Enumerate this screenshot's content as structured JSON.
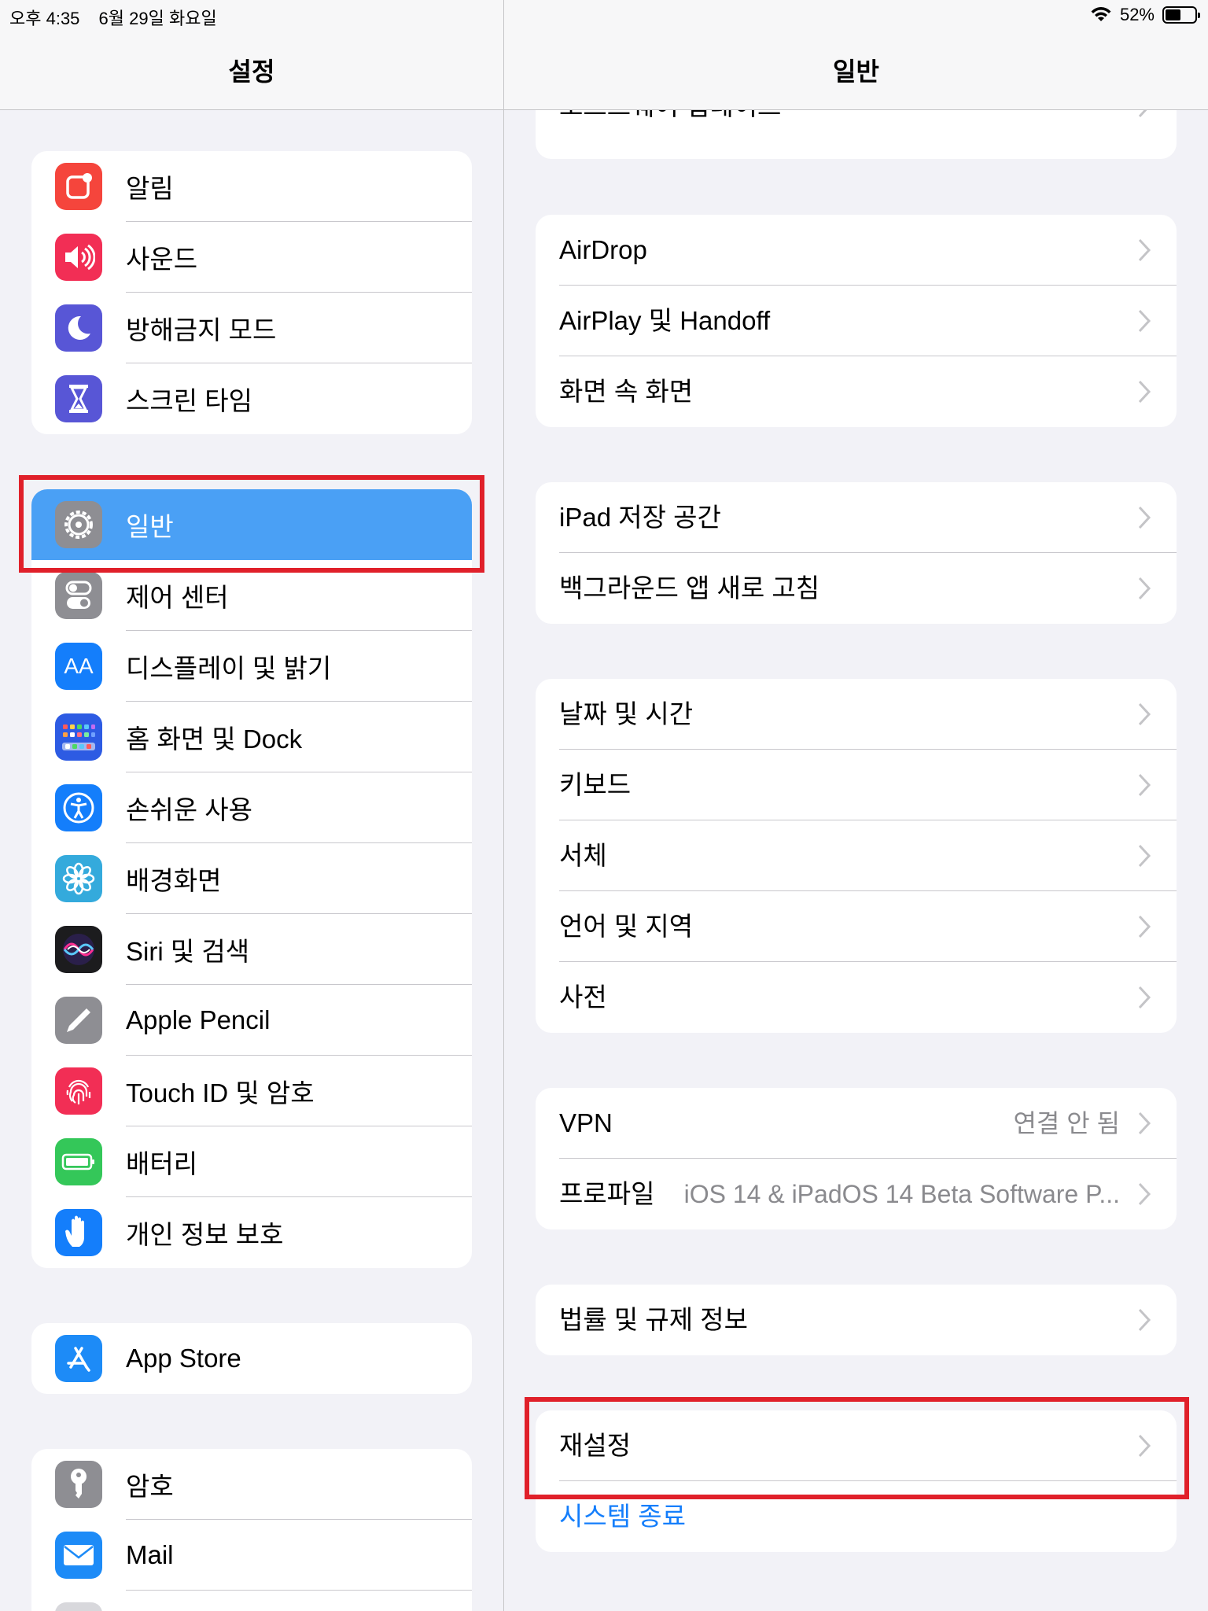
{
  "status_bar": {
    "time": "오후 4:35",
    "date": "6월 29일 화요일",
    "battery_percent": "52%",
    "battery_level": 0.52
  },
  "sidebar": {
    "title": "설정",
    "groups": [
      [
        {
          "label": "알림",
          "icon": "notification-icon",
          "color": "#f5453c"
        },
        {
          "label": "사운드",
          "icon": "speaker-icon",
          "color": "#f22e55"
        },
        {
          "label": "방해금지 모드",
          "icon": "moon-icon",
          "color": "#5856d6"
        },
        {
          "label": "스크린 타임",
          "icon": "hourglass-icon",
          "color": "#5856d6"
        }
      ],
      [
        {
          "label": "일반",
          "icon": "gear-icon",
          "color": "#8e8e93",
          "selected": true
        },
        {
          "label": "제어 센터",
          "icon": "toggle-icon",
          "color": "#8e8e93"
        },
        {
          "label": "디스플레이 및 밝기",
          "icon": "text-size-icon",
          "color": "#147efb"
        },
        {
          "label": "홈 화면 및 Dock",
          "icon": "home-grid-icon",
          "color": "#2d5be3"
        },
        {
          "label": "손쉬운 사용",
          "icon": "accessibility-icon",
          "color": "#147efb"
        },
        {
          "label": "배경화면",
          "icon": "flower-icon",
          "color": "#34aadc"
        },
        {
          "label": "Siri 및 검색",
          "icon": "siri-icon",
          "color": "#1c1c1e"
        },
        {
          "label": "Apple Pencil",
          "icon": "pencil-icon",
          "color": "#8e8e93"
        },
        {
          "label": "Touch ID 및 암호",
          "icon": "fingerprint-icon",
          "color": "#f22e55"
        },
        {
          "label": "배터리",
          "icon": "battery-icon",
          "color": "#34c759"
        },
        {
          "label": "개인 정보 보호",
          "icon": "hand-icon",
          "color": "#147efb"
        }
      ],
      [
        {
          "label": "App Store",
          "icon": "app-store-icon",
          "color": "#1d8bf7"
        }
      ],
      [
        {
          "label": "암호",
          "icon": "key-icon",
          "color": "#8e8e93"
        },
        {
          "label": "Mail",
          "icon": "mail-icon",
          "color": "#1d8bf7"
        }
      ]
    ]
  },
  "detail": {
    "title": "일반",
    "groups": [
      [
        {
          "label": "소프트웨어 업데이트"
        }
      ],
      [
        {
          "label": "AirDrop"
        },
        {
          "label": "AirPlay 및 Handoff"
        },
        {
          "label": "화면 속 화면"
        }
      ],
      [
        {
          "label": "iPad 저장 공간"
        },
        {
          "label": "백그라운드 앱 새로 고침"
        }
      ],
      [
        {
          "label": "날짜 및 시간"
        },
        {
          "label": "키보드"
        },
        {
          "label": "서체"
        },
        {
          "label": "언어 및 지역"
        },
        {
          "label": "사전"
        }
      ],
      [
        {
          "label": "VPN",
          "value": "연결 안 됨"
        },
        {
          "label": "프로파일",
          "value": "iOS 14 & iPadOS 14 Beta Software P..."
        }
      ],
      [
        {
          "label": "법률 및 규제 정보"
        }
      ],
      [
        {
          "label": "재설정"
        },
        {
          "label": "시스템 종료",
          "link": true
        }
      ]
    ]
  },
  "colors": {
    "selected_row": "#4aa0f5",
    "highlight_box": "#e0202a",
    "link": "#147efb"
  }
}
